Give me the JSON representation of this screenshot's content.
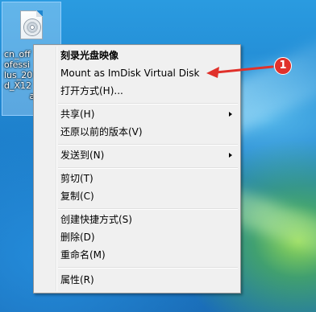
{
  "desktop_icon": {
    "label": "cn_off\nofessi\nlus_20\nd_X12\n         a"
  },
  "context_menu": {
    "items": [
      {
        "label": "刻录光盘映像",
        "bold": true
      },
      {
        "label": "Mount as ImDisk Virtual Disk"
      },
      {
        "label": "打开方式(H)..."
      },
      {
        "label": "共享(H)",
        "submenu": true
      },
      {
        "label": "还原以前的版本(V)"
      },
      {
        "label": "发送到(N)",
        "submenu": true
      },
      {
        "label": "剪切(T)"
      },
      {
        "label": "复制(C)"
      },
      {
        "label": "创建快捷方式(S)"
      },
      {
        "label": "删除(D)"
      },
      {
        "label": "重命名(M)"
      },
      {
        "label": "属性(R)"
      }
    ]
  },
  "annotation": {
    "badge_number": "1",
    "color": "#e0312b"
  }
}
